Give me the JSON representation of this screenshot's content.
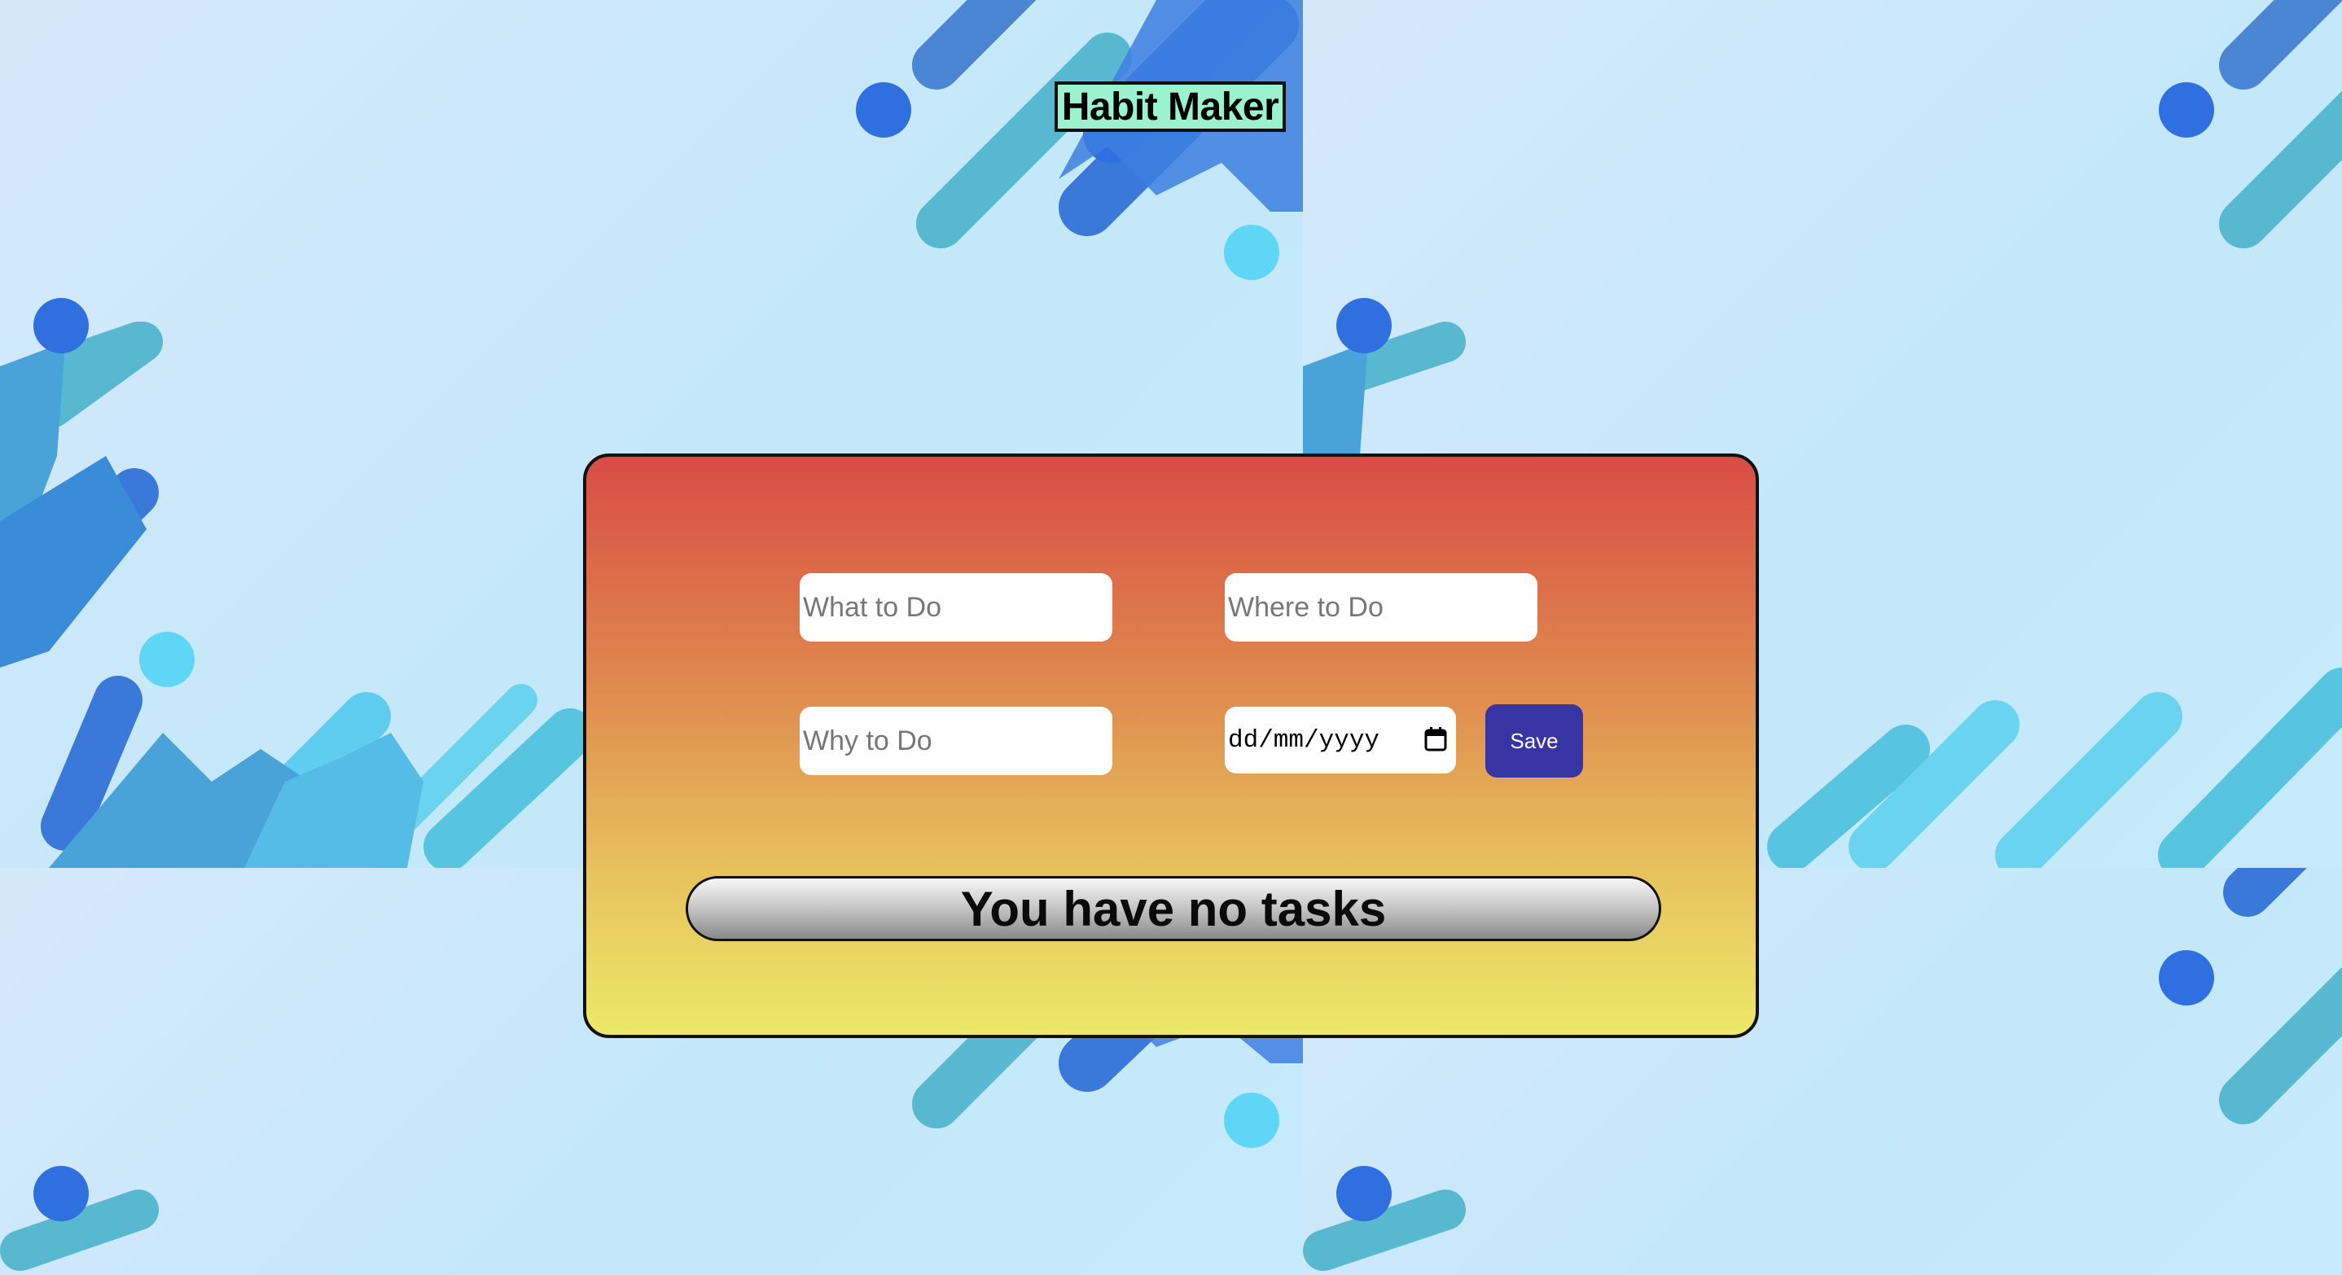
{
  "app": {
    "title": "Habit Maker"
  },
  "form": {
    "what_placeholder": "What to Do",
    "where_placeholder": "Where to Do",
    "why_placeholder": "Why to Do",
    "date_placeholder": "dd/mm/yyyy",
    "save_label": "Save",
    "calendar_icon": "calendar-icon"
  },
  "tasks": {
    "empty_message": "You have no tasks"
  },
  "colors": {
    "title_bg": "#9af2cf",
    "card_top": "#d94c45",
    "card_bottom": "#ece867",
    "save_button": "#3934a3"
  }
}
